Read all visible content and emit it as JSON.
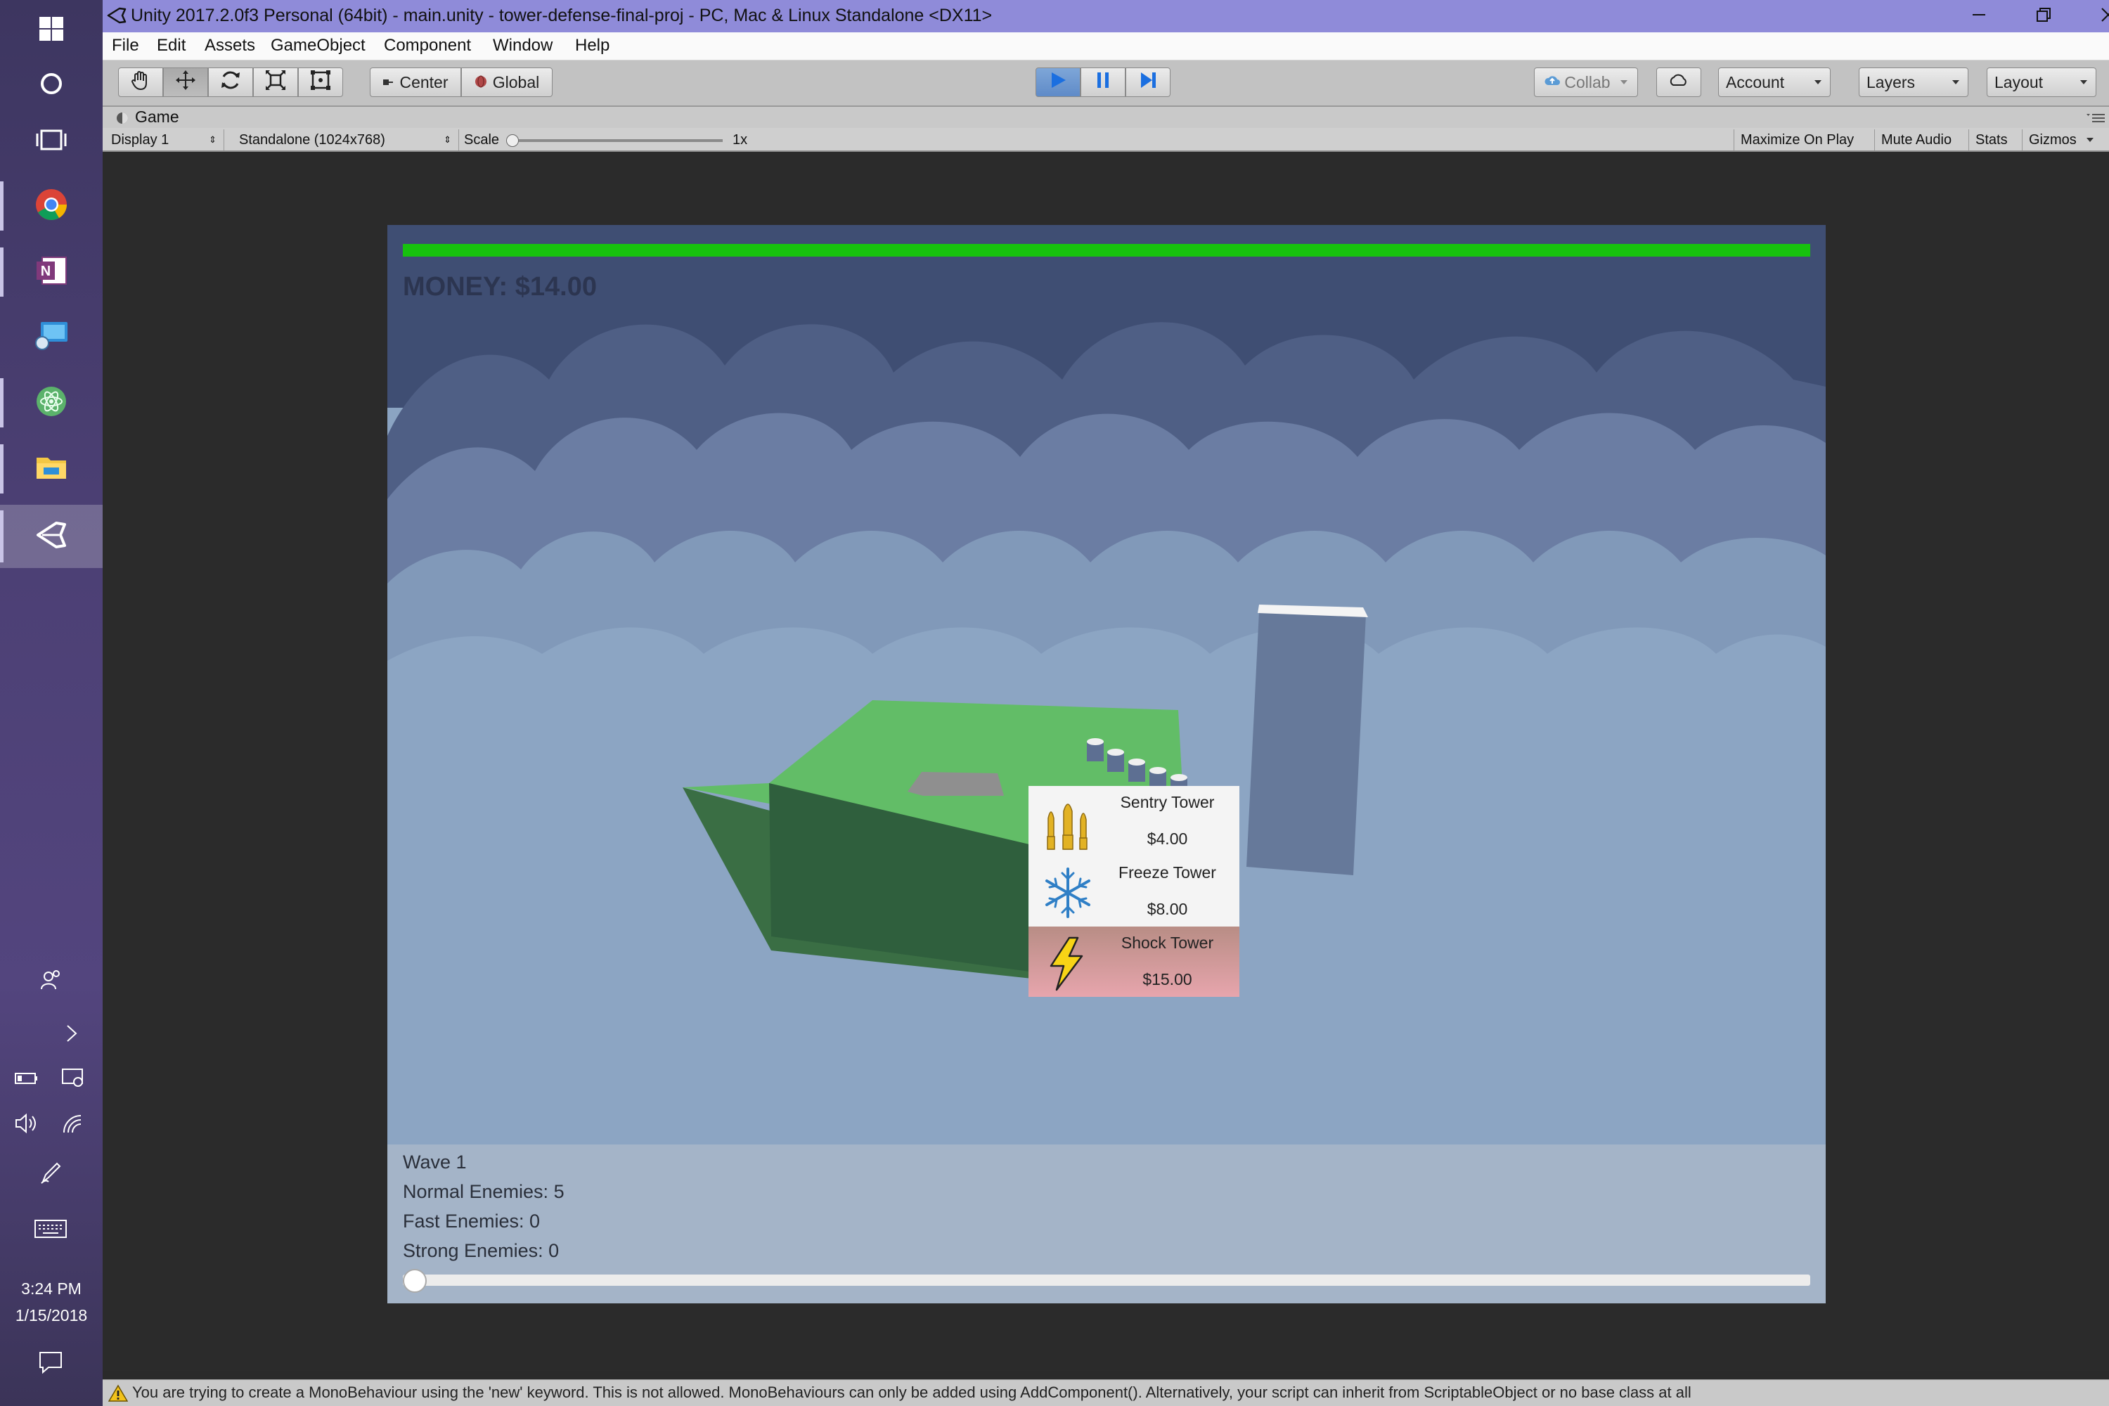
{
  "taskbar": {
    "clock_time": "3:24 PM",
    "clock_date": "1/15/2018",
    "apps": [
      "windows-start-icon",
      "cortana-icon",
      "task-view-icon",
      "chrome-icon",
      "onenote-icon",
      "remote-desktop-icon",
      "atom-icon",
      "file-explorer-icon",
      "unity-icon"
    ]
  },
  "window": {
    "title": "Unity 2017.2.0f3 Personal (64bit) - main.unity - tower-defense-final-proj - PC, Mac & Linux Standalone <DX11>"
  },
  "menu": [
    "File",
    "Edit",
    "Assets",
    "GameObject",
    "Component",
    "Window",
    "Help"
  ],
  "toolbar": {
    "pivot_label": "Center",
    "space_label": "Global",
    "collab_label": "Collab",
    "account_label": "Account",
    "layers_label": "Layers",
    "layout_label": "Layout",
    "play_state": "playing"
  },
  "game_tab": {
    "title": "Game",
    "display": "Display 1",
    "resolution": "Standalone (1024x768)",
    "scale_label": "Scale",
    "scale_value": "1x",
    "maximize_on_play": "Maximize On Play",
    "mute_audio": "Mute Audio",
    "stats": "Stats",
    "gizmos": "Gizmos"
  },
  "game": {
    "money": "MONEY: $14.00",
    "health_fraction": 1.0,
    "towers": [
      {
        "name": "Sentry Tower",
        "price": "$4.00",
        "icon": "bullets-icon"
      },
      {
        "name": "Freeze Tower",
        "price": "$8.00",
        "icon": "snowflake-icon"
      },
      {
        "name": "Shock Tower",
        "price": "$15.00",
        "icon": "lightning-icon",
        "selected": true
      }
    ],
    "wave": {
      "title": "Wave 1",
      "normal": "Normal Enemies: 5",
      "fast": "Fast Enemies: 0",
      "strong": "Strong Enemies: 0"
    },
    "wave_progress": 0.0,
    "colors": {
      "health": "#17c20e",
      "ground_top": "#62bd67",
      "ground_side": "#2f5f3d"
    }
  },
  "status": {
    "message": "You are trying to create a MonoBehaviour using the 'new' keyword.  This is not allowed.  MonoBehaviours can only be added using AddComponent().  Alternatively, your script can inherit from ScriptableObject or no base class at all"
  }
}
